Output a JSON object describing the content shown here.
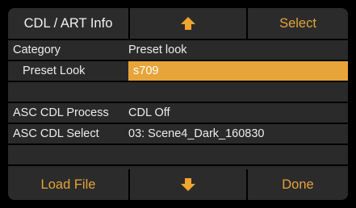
{
  "top_bar": {
    "title": "CDL / ART Info",
    "up_icon": "arrow-up-icon",
    "select_label": "Select"
  },
  "rows": {
    "category_label": "Category",
    "category_value": "Preset look",
    "preset_look_label": "Preset Look",
    "preset_look_value": "s709",
    "asc_cdl_process_label": "ASC CDL Process",
    "asc_cdl_process_value": "CDL Off",
    "asc_cdl_select_label": "ASC CDL Select",
    "asc_cdl_select_value": "03: Scene4_Dark_160830"
  },
  "bottom_bar": {
    "load_file_label": "Load File",
    "down_icon": "arrow-down-icon",
    "done_label": "Done"
  },
  "colors": {
    "accent": "#e6a43a",
    "button_bg": "#2b2b2b",
    "row_bg": "#2a2a2a",
    "text": "#ececec"
  }
}
